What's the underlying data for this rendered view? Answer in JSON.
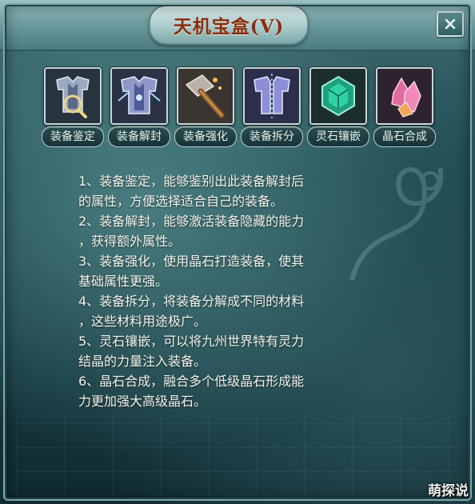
{
  "window": {
    "title": "天机宝盒(V)",
    "close_icon": "close-icon"
  },
  "tools": [
    {
      "label": "装备鉴定",
      "icon": "appraise-armor-icon"
    },
    {
      "label": "装备解封",
      "icon": "unseal-armor-icon"
    },
    {
      "label": "装备强化",
      "icon": "hammer-icon"
    },
    {
      "label": "装备拆分",
      "icon": "disassemble-armor-icon"
    },
    {
      "label": "灵石镶嵌",
      "icon": "green-gem-icon"
    },
    {
      "label": "晶石合成",
      "icon": "pink-crystal-icon"
    }
  ],
  "description": [
    "1、装备鉴定，能够鉴别出此装备解封后",
    "的属性，方便选择适合自己的装备。",
    "2、装备解封，能够激活装备隐藏的能力",
    "，获得额外属性。",
    "3、装备强化，使用晶石打造装备，使其",
    "基础属性更强。",
    "4、装备拆分，将装备分解成不同的材料",
    "，这些材料用途极广。",
    "5、灵石镶嵌，可以将九州世界特有灵力",
    "结晶的力量注入装备。",
    "6、晶石合成，融合多个低级晶石形成能",
    "力更加强大高级晶石。"
  ],
  "watermark": "萌探说",
  "colors": {
    "title_text": "#8a2d10",
    "panel_bg": "#1f4a50",
    "label_text": "#e8efe6"
  }
}
